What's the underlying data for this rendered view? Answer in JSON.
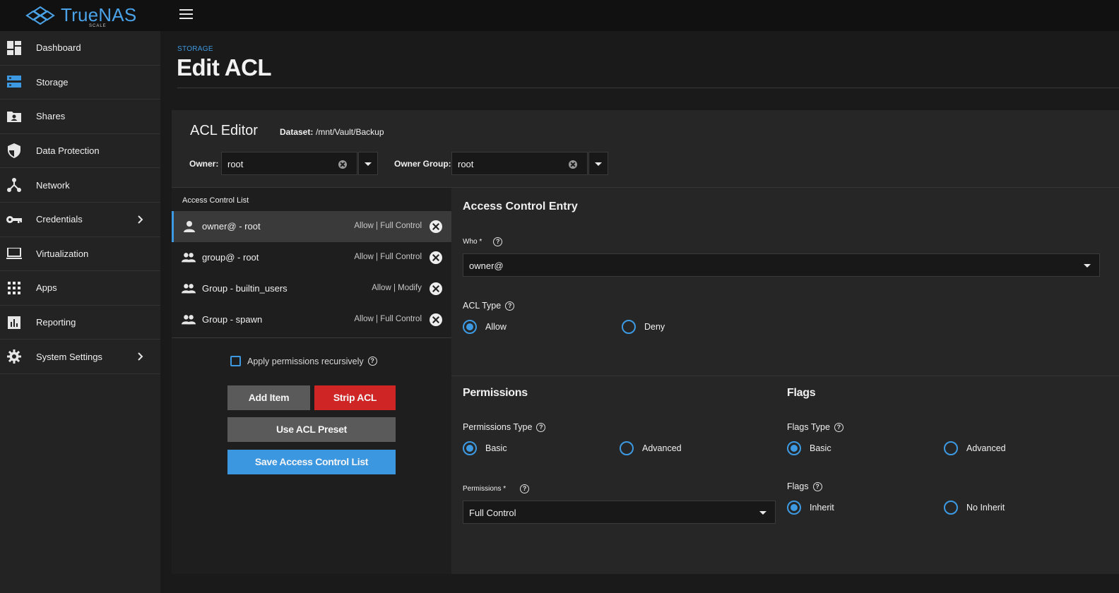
{
  "app": {
    "logo_text": "TrueNAS",
    "logo_subtitle": "SCALE",
    "accent_color": "#3d9ae2"
  },
  "sidebar": {
    "items": [
      {
        "label": "Dashboard",
        "icon": "dashboard-icon"
      },
      {
        "label": "Storage",
        "icon": "storage-icon"
      },
      {
        "label": "Shares",
        "icon": "shares-icon"
      },
      {
        "label": "Data Protection",
        "icon": "shield-icon"
      },
      {
        "label": "Network",
        "icon": "network-icon"
      },
      {
        "label": "Credentials",
        "icon": "key-icon",
        "has_submenu": true
      },
      {
        "label": "Virtualization",
        "icon": "laptop-icon"
      },
      {
        "label": "Apps",
        "icon": "apps-grid-icon"
      },
      {
        "label": "Reporting",
        "icon": "bar-chart-icon"
      },
      {
        "label": "System Settings",
        "icon": "gear-icon",
        "has_submenu": true
      }
    ]
  },
  "page": {
    "breadcrumb": "STORAGE",
    "title": "Edit ACL"
  },
  "editor": {
    "title": "ACL Editor",
    "dataset_label": "Dataset:",
    "dataset_path": "/mnt/Vault/Backup",
    "owner_label": "Owner:",
    "owner_value": "root",
    "owner_group_label": "Owner Group:",
    "owner_group_value": "root"
  },
  "acl_list": {
    "heading": "Access Control List",
    "entries": [
      {
        "who": "owner@ - root",
        "perm": "Allow | Full Control",
        "icon": "person-icon",
        "selected": true
      },
      {
        "who": "group@ - root",
        "perm": "Allow | Full Control",
        "icon": "group-icon",
        "selected": false
      },
      {
        "who": "Group - builtin_users",
        "perm": "Allow | Modify",
        "icon": "group-icon",
        "selected": false
      },
      {
        "who": "Group - spawn",
        "perm": "Allow | Full Control",
        "icon": "group-icon",
        "selected": false
      }
    ],
    "apply_recursive_label": "Apply permissions recursively",
    "apply_recursive_checked": false,
    "buttons": {
      "add_item": "Add Item",
      "strip_acl": "Strip ACL",
      "use_preset": "Use ACL Preset",
      "save": "Save Access Control List"
    }
  },
  "ace": {
    "title": "Access Control Entry",
    "who_label": "Who *",
    "who_value": "owner@",
    "acl_type_label": "ACL Type",
    "acl_type_options": [
      "Allow",
      "Deny"
    ],
    "acl_type_selected": "Allow",
    "permissions_title": "Permissions",
    "permissions_type_label": "Permissions Type",
    "permissions_type_options": [
      "Basic",
      "Advanced"
    ],
    "permissions_type_selected": "Basic",
    "permissions_label": "Permissions *",
    "permissions_value": "Full Control",
    "flags_title": "Flags",
    "flags_type_label": "Flags Type",
    "flags_type_options": [
      "Basic",
      "Advanced"
    ],
    "flags_type_selected": "Basic",
    "flags_label": "Flags",
    "flags_options": [
      "Inherit",
      "No Inherit"
    ],
    "flags_selected": "Inherit"
  }
}
